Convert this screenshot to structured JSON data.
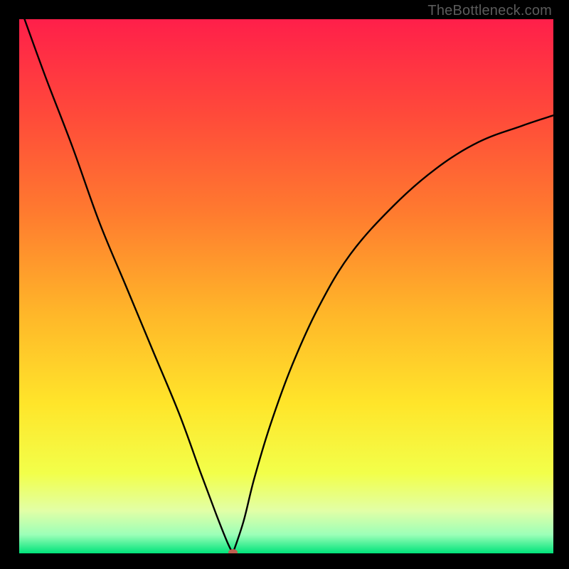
{
  "watermark": "TheBottleneck.com",
  "colors": {
    "frame": "#000000",
    "curve": "#000000",
    "gradient_stops": [
      {
        "pos": 0.0,
        "color": "#ff1f4a"
      },
      {
        "pos": 0.18,
        "color": "#ff4a3a"
      },
      {
        "pos": 0.36,
        "color": "#ff7a2f"
      },
      {
        "pos": 0.55,
        "color": "#ffb629"
      },
      {
        "pos": 0.72,
        "color": "#ffe52a"
      },
      {
        "pos": 0.85,
        "color": "#f2ff4a"
      },
      {
        "pos": 0.92,
        "color": "#e2ffa6"
      },
      {
        "pos": 0.965,
        "color": "#9cffb8"
      },
      {
        "pos": 1.0,
        "color": "#00e37a"
      }
    ],
    "vertex_dot": "#be5f50"
  },
  "chart_data": {
    "type": "line",
    "title": "",
    "xlabel": "",
    "ylabel": "",
    "xlim": [
      0,
      1
    ],
    "ylim": [
      0,
      1
    ],
    "vertex": {
      "x": 0.4,
      "y": 0.0
    },
    "series": [
      {
        "name": "left-branch",
        "x": [
          0.01,
          0.05,
          0.1,
          0.15,
          0.2,
          0.25,
          0.3,
          0.34,
          0.37,
          0.39,
          0.4
        ],
        "values": [
          1.0,
          0.89,
          0.76,
          0.62,
          0.5,
          0.38,
          0.26,
          0.15,
          0.07,
          0.02,
          0.0
        ]
      },
      {
        "name": "right-branch",
        "x": [
          0.4,
          0.42,
          0.44,
          0.47,
          0.51,
          0.56,
          0.62,
          0.7,
          0.78,
          0.86,
          0.94,
          1.0
        ],
        "values": [
          0.0,
          0.06,
          0.14,
          0.24,
          0.35,
          0.46,
          0.56,
          0.65,
          0.72,
          0.77,
          0.8,
          0.82
        ]
      }
    ]
  }
}
